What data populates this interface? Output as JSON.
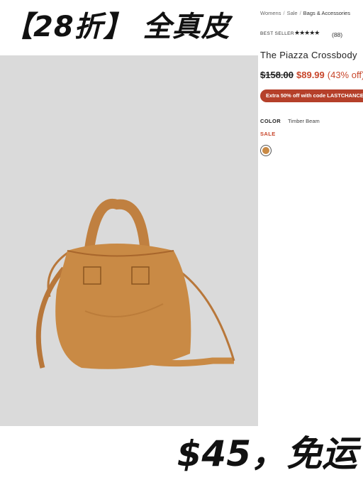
{
  "headline": "【28折】 全真皮",
  "price_promo": "$45，免运",
  "product": {
    "breadcrumb": [
      "Womens",
      "Sale",
      "Bags & Accessories"
    ],
    "badge": "BEST SELLER",
    "rating_stars": "★★★★★",
    "review_count": "(88)",
    "title": "The Piazza Crossbody",
    "original_price": "$158.00",
    "sale_price": "$89.99",
    "discount": "(43% off)",
    "promo": "Extra 50% off with code LASTCHANCE",
    "color_label": "COLOR",
    "color_value": "Timber Beam",
    "sale_label": "SALE",
    "swatch_color": "#c98a45"
  },
  "colors": {
    "accent": "#c8462b",
    "promo_bg": "#b5402a",
    "bag": "#c98a45"
  }
}
